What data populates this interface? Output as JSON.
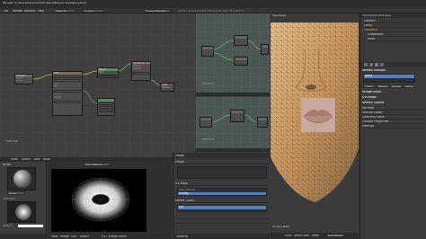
{
  "window": {
    "title": "Blender [C:\\Users\\Cartoonist\\Dropbox\\Blender Files\\lips.blend]"
  },
  "topbar": {
    "menus": [
      "File",
      "Render",
      "Window",
      "Help"
    ],
    "layout": "Default",
    "scene": "Scene",
    "engine": "Cycles Render",
    "stats": "v2.76 | Verts:2/12,396 | Faces:0/12,186 | Tris:24,372"
  },
  "node_editor": {
    "editor_name": "Interface",
    "nodes": [
      {
        "title": "Image",
        "rows": [
          "Color",
          "Alpha"
        ]
      },
      {
        "title": "Mix",
        "rows": [
          "Color",
          "Fac",
          "Color1",
          "Color2"
        ]
      },
      {
        "title": "BSDF",
        "rows": [
          "BSDF",
          "Color",
          "Roughness"
        ]
      },
      {
        "title": "Material Output",
        "rows": [
          "Surface",
          "Volume"
        ]
      },
      {
        "title": "Out",
        "rows": [
          "Surface"
        ]
      }
    ],
    "footer_menus": [
      "View",
      "Select",
      "Add",
      "Node"
    ]
  },
  "node_editor_2": {
    "label": "Interface"
  },
  "node_editor_3": {
    "label": "Interface"
  },
  "viewport": {
    "info": "User Persp",
    "object": "(1) Lips_Mesh",
    "mode": "Edit Mode",
    "footer_menus": [
      "View",
      "Select",
      "Add",
      "Mesh"
    ]
  },
  "outliner": {
    "header": "View  Search  All Scenes",
    "items": [
      "Camera",
      "Lamp",
      "LipsMesh",
      "ShapeKeys",
      "Mesh"
    ],
    "selected": "LipsMesh"
  },
  "properties": {
    "tabs": [
      "Vertex Groups",
      "Shape Keys",
      "UV Maps",
      "Vertex Colors"
    ],
    "active": "Basis",
    "sections": [
      "Normals",
      "Texture Space",
      "Geometry Data",
      "Custom Properties",
      "Settings"
    ],
    "buttons": [
      "Add",
      "Remove",
      "Assign",
      "Select",
      "Deselect"
    ]
  },
  "image_editor": {
    "image": "lips_diffuse",
    "footer_menus": [
      "View",
      "Image",
      "UVs",
      "Select"
    ],
    "label": "UV / Image Editor"
  },
  "tool_panel": {
    "brush": "Draw",
    "labels": [
      "Brush",
      "Strength",
      "Radius",
      "Color"
    ]
  },
  "image_props": {
    "header": "Image",
    "sections": [
      "Image",
      "UV Maps",
      "Vertex Colors"
    ],
    "fields": [
      "lips_diffuse",
      "UVMap",
      "Col"
    ]
  },
  "status": {
    "footer_left": "Shading",
    "footer_right": "Edit Mode"
  }
}
